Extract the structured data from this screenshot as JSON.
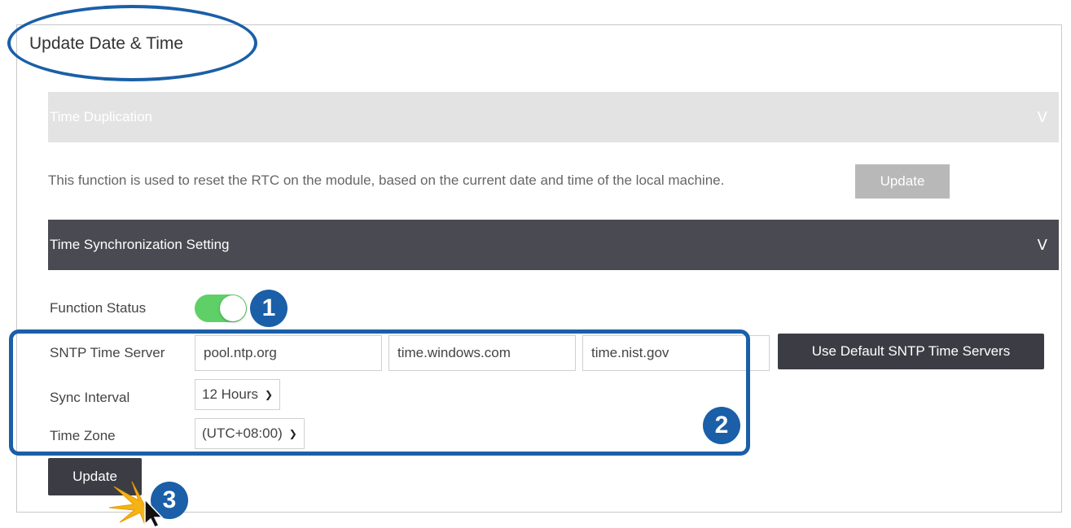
{
  "panel": {
    "title": "Update Date & Time"
  },
  "time_duplication": {
    "header": "Time Duplication",
    "chevron": "V",
    "description": "This function is used to reset the RTC on the module, based on the current date and time of the local machine.",
    "update_label": "Update"
  },
  "time_sync": {
    "header": "Time Synchronization Setting",
    "chevron": "V",
    "function_status_label": "Function Status",
    "function_status_on": true,
    "sntp_label": "SNTP Time Server",
    "sntp_servers": [
      "pool.ntp.org",
      "time.windows.com",
      "time.nist.gov"
    ],
    "default_servers_button": "Use Default SNTP Time Servers",
    "sync_interval_label": "Sync Interval",
    "sync_interval_value": "12 Hours",
    "time_zone_label": "Time Zone",
    "time_zone_value": "(UTC+08:00)",
    "update_label": "Update"
  },
  "annotations": {
    "step1": "1",
    "step2": "2",
    "step3": "3",
    "color": "#1a5fa8"
  },
  "colors": {
    "toggle_on": "#5fd068",
    "dark_header": "#4a4a52",
    "dark_button": "#3c3d44"
  }
}
